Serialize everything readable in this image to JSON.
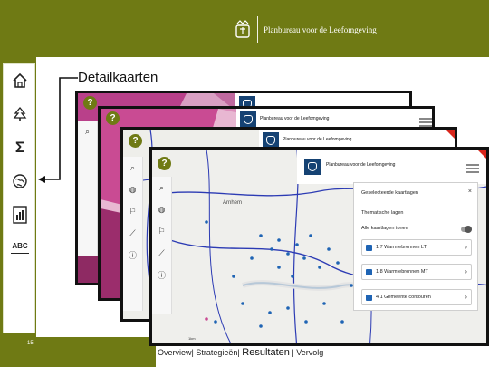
{
  "brand": {
    "name": "Planbureau voor de Leefomgeving"
  },
  "slide": {
    "page_number": "15",
    "callout": "Detailkaarten"
  },
  "nav": {
    "items": [
      {
        "name": "home-icon",
        "glyph": "⌂"
      },
      {
        "name": "tree-icon",
        "glyph": "❦"
      },
      {
        "name": "sigma-icon",
        "glyph": "Σ"
      },
      {
        "name": "globe-icon",
        "glyph": "⊕"
      },
      {
        "name": "document-chart-icon",
        "glyph": "▤"
      },
      {
        "name": "abc-icon",
        "glyph": "ABC"
      }
    ]
  },
  "footer": {
    "overview": "Overview",
    "strategieen": "Strategieën",
    "resultaten": "Resultaten",
    "vervolg": "Vervolg",
    "sep": "|"
  },
  "map": {
    "header_text": "Planbureau voor de Leefomgeving",
    "help_label": "?",
    "city_label": "Arnhem",
    "scale_label": "1km",
    "tools": [
      "⌕",
      "◍",
      "⚐",
      "⟋",
      "ⓘ"
    ]
  },
  "layer_panel": {
    "title": "Geselecteerde kaartlagen",
    "section": "Thematische lagen",
    "open_all": "Alle kaartlagen tonen",
    "layers": [
      {
        "label": "1.7 Warmtebronnen LT"
      },
      {
        "label": "1.8 Warmtebronnen MT"
      },
      {
        "label": "4.1 Gemeente contouren"
      }
    ]
  },
  "colors": {
    "band": "#6f7a14",
    "magenta_map": "#b9408a",
    "pink_map": "#c94b93",
    "accent_red": "#d9261c",
    "point_blue": "#1f64b4"
  }
}
